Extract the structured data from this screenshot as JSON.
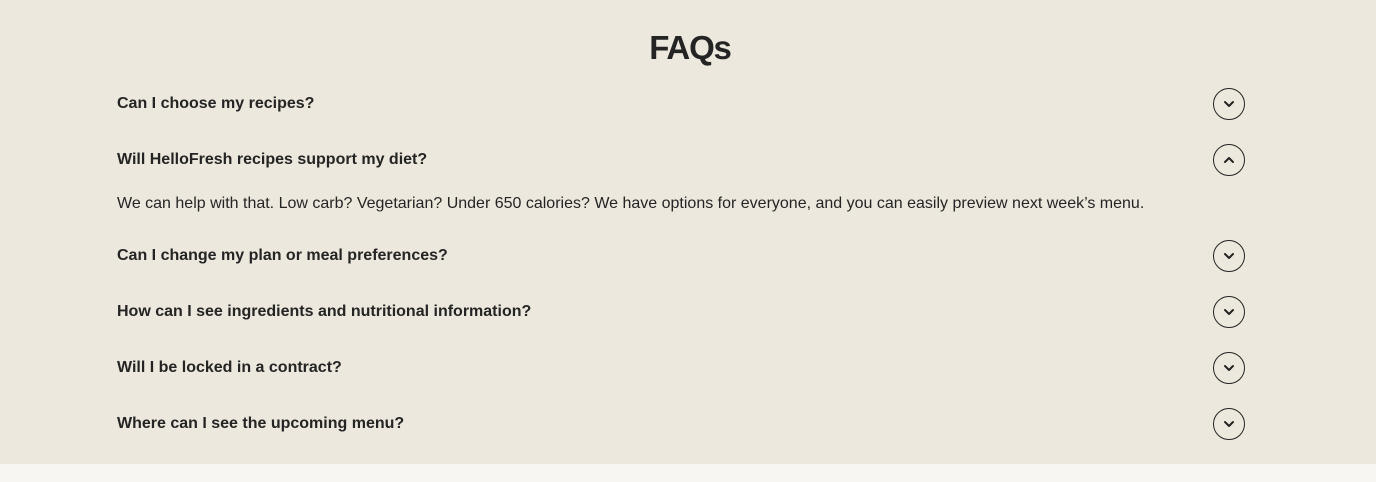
{
  "faq": {
    "title": "FAQs",
    "items": [
      {
        "question": "Can I choose my recipes?",
        "expanded": false,
        "toggle_icon": "chevron-down-icon"
      },
      {
        "question": "Will HelloFresh recipes support my diet?",
        "expanded": true,
        "toggle_icon": "chevron-up-icon",
        "answer": "We can help with that. Low carb? Vegetarian? Under 650 calories? We have options for everyone, and you can easily preview next week’s menu."
      },
      {
        "question": "Can I change my plan or meal preferences?",
        "expanded": false,
        "toggle_icon": "chevron-down-icon"
      },
      {
        "question": "How can I see ingredients and nutritional information?",
        "expanded": false,
        "toggle_icon": "chevron-down-icon"
      },
      {
        "question": "Will I be locked in a contract?",
        "expanded": false,
        "toggle_icon": "chevron-down-icon"
      },
      {
        "question": "Where can I see the upcoming menu?",
        "expanded": false,
        "toggle_icon": "chevron-down-icon"
      }
    ]
  },
  "colors": {
    "section_background": "#ede8dd",
    "page_background": "#f7f6f2",
    "text": "#242424"
  }
}
